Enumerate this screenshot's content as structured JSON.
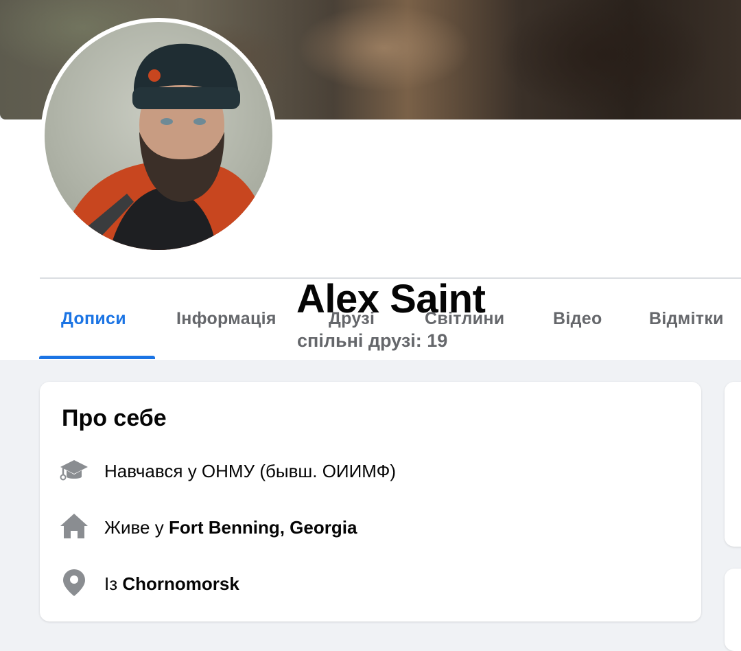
{
  "profile": {
    "name": "Alex Saint",
    "mutual_friends": "спільні друзі: 19"
  },
  "tabs": [
    {
      "label": "Дописи",
      "active": true
    },
    {
      "label": "Інформація",
      "active": false
    },
    {
      "label": "Друзі",
      "active": false
    },
    {
      "label": "Світлини",
      "active": false
    },
    {
      "label": "Відео",
      "active": false
    },
    {
      "label": "Відмітки",
      "active": false
    }
  ],
  "about": {
    "title": "Про себе",
    "education": {
      "icon": "graduation-cap-icon",
      "text": "Навчався у ОНМУ (бывш. ОИИМФ)"
    },
    "lives": {
      "icon": "home-icon",
      "prefix": "Живе у ",
      "place": "Fort Benning, Georgia"
    },
    "from": {
      "icon": "location-pin-icon",
      "prefix": "Із ",
      "place": "Chornomorsk"
    }
  },
  "colors": {
    "accent": "#1b74e4",
    "secondary_text": "#65676b",
    "background": "#f0f2f5",
    "icon_gray": "#8a8d91"
  }
}
